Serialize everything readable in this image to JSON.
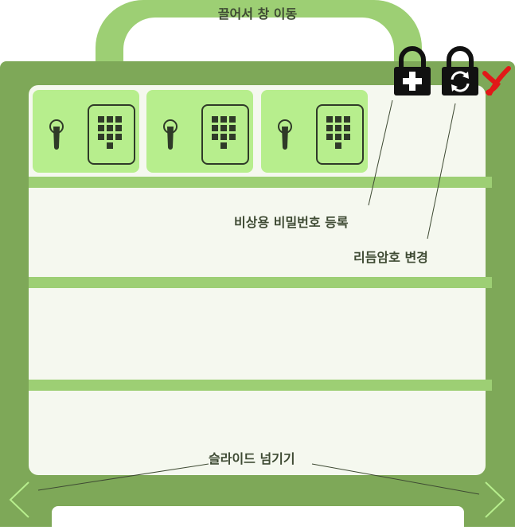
{
  "window": {
    "drag_label": "끌어서 창 이동"
  },
  "toolbar": {
    "emergency_register_icon": "lock-plus-icon",
    "rhythm_change_icon": "lock-refresh-icon",
    "close_icon": "close-x-icon"
  },
  "annotations": {
    "emergency_password": "비상용 비밀번호 등록",
    "rhythm_password": "리듬암호 변경",
    "slide_nav": "슬라이드 넘기기"
  },
  "cards": [
    {
      "icon": "door-lock-keypad-icon"
    },
    {
      "icon": "door-lock-keypad-icon"
    },
    {
      "icon": "door-lock-keypad-icon"
    }
  ],
  "colors": {
    "frame": "#7ea858",
    "handle": "#9dcf74",
    "card": "#b7ee8d",
    "close": "#e21818"
  }
}
